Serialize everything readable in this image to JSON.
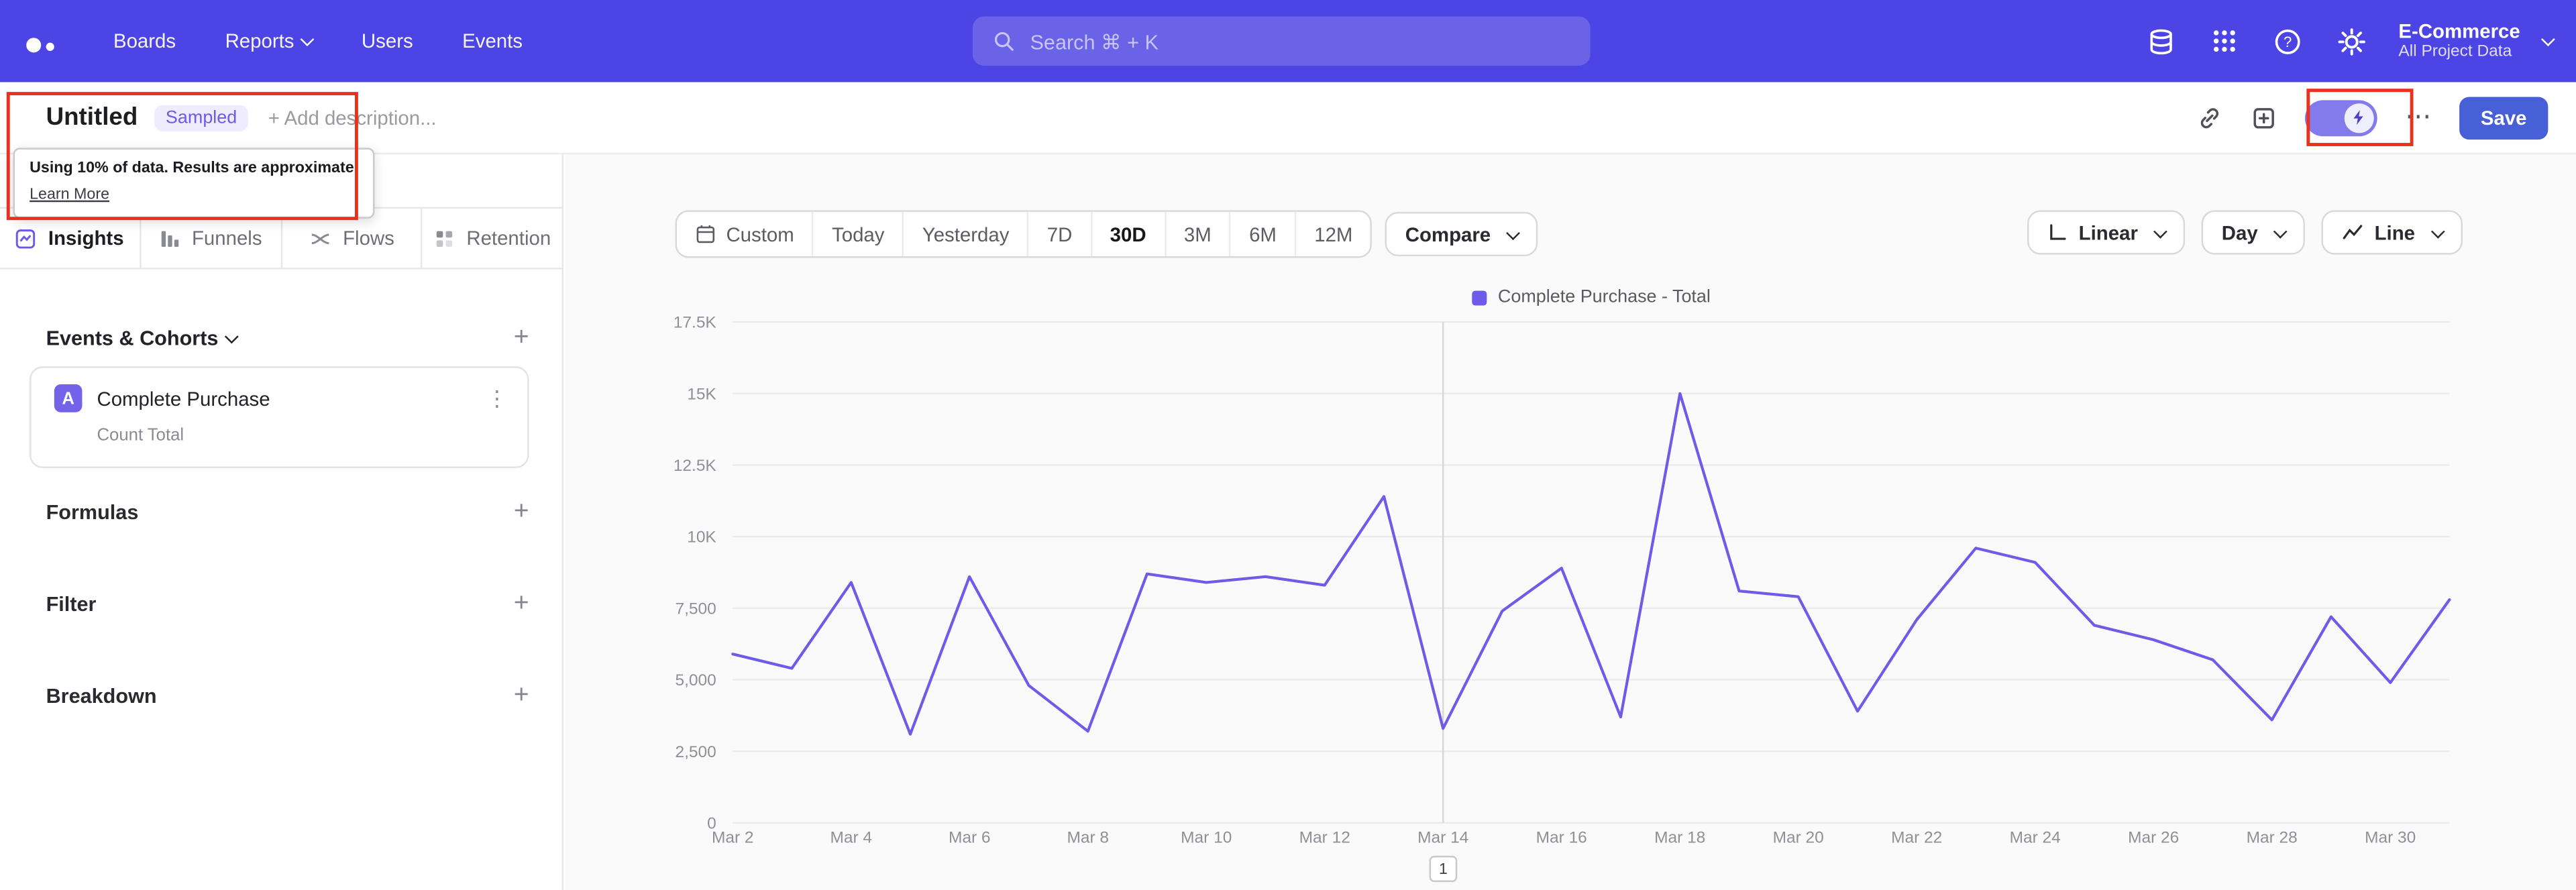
{
  "colors": {
    "topbar": "#4c44e4",
    "accent_purple": "#6e5be8",
    "save_button": "#4760d8",
    "annotation_red": "#e8321e",
    "sampled_badge": "#6f59e8"
  },
  "topnav": {
    "items": [
      "Boards",
      "Reports",
      "Users",
      "Events"
    ],
    "search_placeholder": "Search  ⌘ + K",
    "project_name": "E-Commerce",
    "project_scope": "All Project Data"
  },
  "report_header": {
    "title": "Untitled",
    "badge": "Sampled",
    "add_description": "+ Add description...",
    "save_label": "Save"
  },
  "tooltip": {
    "text": "Using 10% of data. Results are approximate.",
    "link": "Learn More"
  },
  "tabs": [
    "Insights",
    "Funnels",
    "Flows",
    "Retention"
  ],
  "builder": {
    "events_cohorts_label": "Events & Cohorts",
    "event": {
      "letter": "A",
      "name": "Complete Purchase",
      "metric": "Count Total"
    },
    "sections": [
      "Formulas",
      "Filter",
      "Breakdown"
    ]
  },
  "controls": {
    "ranges": [
      "Custom",
      "Today",
      "Yesterday",
      "7D",
      "30D",
      "3M",
      "6M",
      "12M"
    ],
    "selected_range": "30D",
    "compare_label": "Compare",
    "scale_label": "Linear",
    "interval_label": "Day",
    "chart_type_label": "Line"
  },
  "chart_data": {
    "type": "line",
    "title": "",
    "legend": "Complete Purchase - Total",
    "legend_position": "top-center",
    "series_color": "#6e5be8",
    "grid": true,
    "ylim": [
      0,
      17500
    ],
    "x": [
      "Mar 2",
      "Mar 3",
      "Mar 4",
      "Mar 5",
      "Mar 6",
      "Mar 7",
      "Mar 8",
      "Mar 9",
      "Mar 10",
      "Mar 11",
      "Mar 12",
      "Mar 13",
      "Mar 14",
      "Mar 15",
      "Mar 16",
      "Mar 17",
      "Mar 18",
      "Mar 19",
      "Mar 20",
      "Mar 21",
      "Mar 22",
      "Mar 23",
      "Mar 24",
      "Mar 25",
      "Mar 26",
      "Mar 27",
      "Mar 28",
      "Mar 29",
      "Mar 30",
      "Mar 31"
    ],
    "values": [
      5900,
      5400,
      8400,
      3100,
      8600,
      4800,
      3200,
      8700,
      8400,
      8600,
      8300,
      11400,
      3300,
      7400,
      8900,
      3700,
      15000,
      8100,
      7900,
      3900,
      7100,
      9600,
      9100,
      6900,
      6400,
      5700,
      3600,
      7200,
      4900,
      7800
    ],
    "x_tick_labels": [
      "Mar 2",
      "Mar 4",
      "Mar 6",
      "Mar 8",
      "Mar 10",
      "Mar 12",
      "Mar 14",
      "Mar 16",
      "Mar 18",
      "Mar 20",
      "Mar 22",
      "Mar 24",
      "Mar 26",
      "Mar 28",
      "Mar 30"
    ],
    "y_ticks": [
      {
        "value": 17500,
        "label": "17.5K"
      },
      {
        "value": 15000,
        "label": "15K"
      },
      {
        "value": 12500,
        "label": "12.5K"
      },
      {
        "value": 10000,
        "label": "10K"
      },
      {
        "value": 7500,
        "label": "7,500"
      },
      {
        "value": 5000,
        "label": "5,000"
      },
      {
        "value": 2500,
        "label": "2,500"
      },
      {
        "value": 0,
        "label": "0"
      }
    ],
    "marker": {
      "x_index": 12,
      "label": "1"
    }
  }
}
